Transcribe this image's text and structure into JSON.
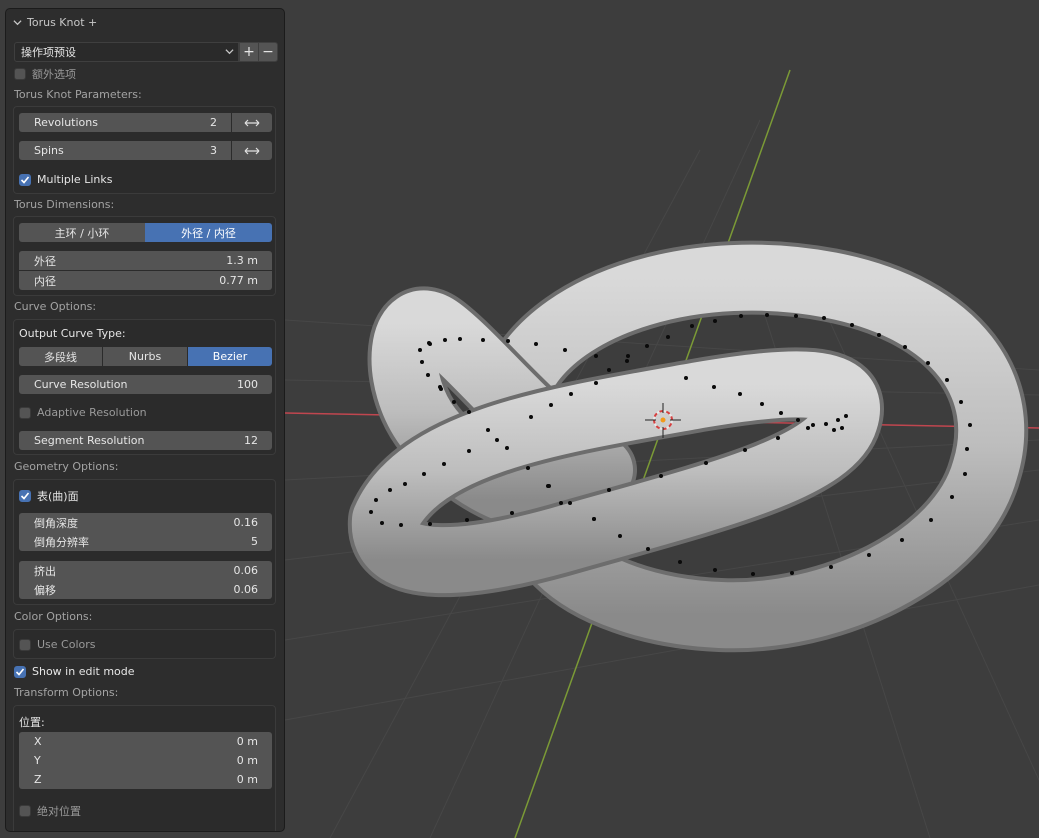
{
  "panel": {
    "title": "Torus Knot +",
    "preset": {
      "label": "操作项预设",
      "add": "+",
      "remove": "−"
    },
    "extra_options": {
      "label": "额外选项",
      "checked": false
    },
    "torus_knot_params": {
      "heading": "Torus Knot Parameters:",
      "revolutions": {
        "label": "Revolutions",
        "value": "2"
      },
      "spins": {
        "label": "Spins",
        "value": "3"
      },
      "multiple_links": {
        "label": "Multiple Links",
        "checked": true
      }
    },
    "torus_dimensions": {
      "heading": "Torus Dimensions:",
      "mode_options": [
        "主环 / 小环",
        "外径 / 内径"
      ],
      "mode_selected": "外径 / 内径",
      "outer": {
        "label": "外径",
        "value": "1.3 m"
      },
      "inner": {
        "label": "内径",
        "value": "0.77 m"
      }
    },
    "curve_options": {
      "heading": "Curve Options:",
      "output_type_label": "Output Curve Type:",
      "types": [
        "多段线",
        "Nurbs",
        "Bezier"
      ],
      "type_selected": "Bezier",
      "curve_resolution": {
        "label": "Curve Resolution",
        "value": "100"
      },
      "adaptive_resolution": {
        "label": "Adaptive Resolution",
        "checked": false
      },
      "segment_resolution": {
        "label": "Segment Resolution",
        "value": "12"
      }
    },
    "geometry_options": {
      "heading": "Geometry Options:",
      "surface": {
        "label": "表(曲)面",
        "checked": true
      },
      "bevel_depth": {
        "label": "倒角深度",
        "value": "0.16"
      },
      "bevel_resolution": {
        "label": "倒角分辨率",
        "value": "5"
      },
      "extrude": {
        "label": "挤出",
        "value": "0.06"
      },
      "offset": {
        "label": "偏移",
        "value": "0.06"
      }
    },
    "color_options": {
      "heading": "Color Options:",
      "use_colors": {
        "label": "Use Colors",
        "checked": false
      }
    },
    "show_in_edit_mode": {
      "label": "Show in edit mode",
      "checked": true
    },
    "transform_options": {
      "heading": "Transform Options:",
      "location_label": "位置:",
      "x": {
        "label": "X",
        "value": "0 m"
      },
      "y": {
        "label": "Y",
        "value": "0 m"
      },
      "z": {
        "label": "Z",
        "value": "0 m"
      },
      "absolute": {
        "label": "绝对位置",
        "checked": false
      }
    }
  },
  "colors": {
    "accent": "#4772b3",
    "viewport_bg": "#3d3d3d",
    "panel_bg": "#2d2d2d",
    "field_bg": "#545454",
    "x_axis": "#c0464f",
    "y_axis": "#7b9a36",
    "mesh": "#bdbdbd"
  }
}
